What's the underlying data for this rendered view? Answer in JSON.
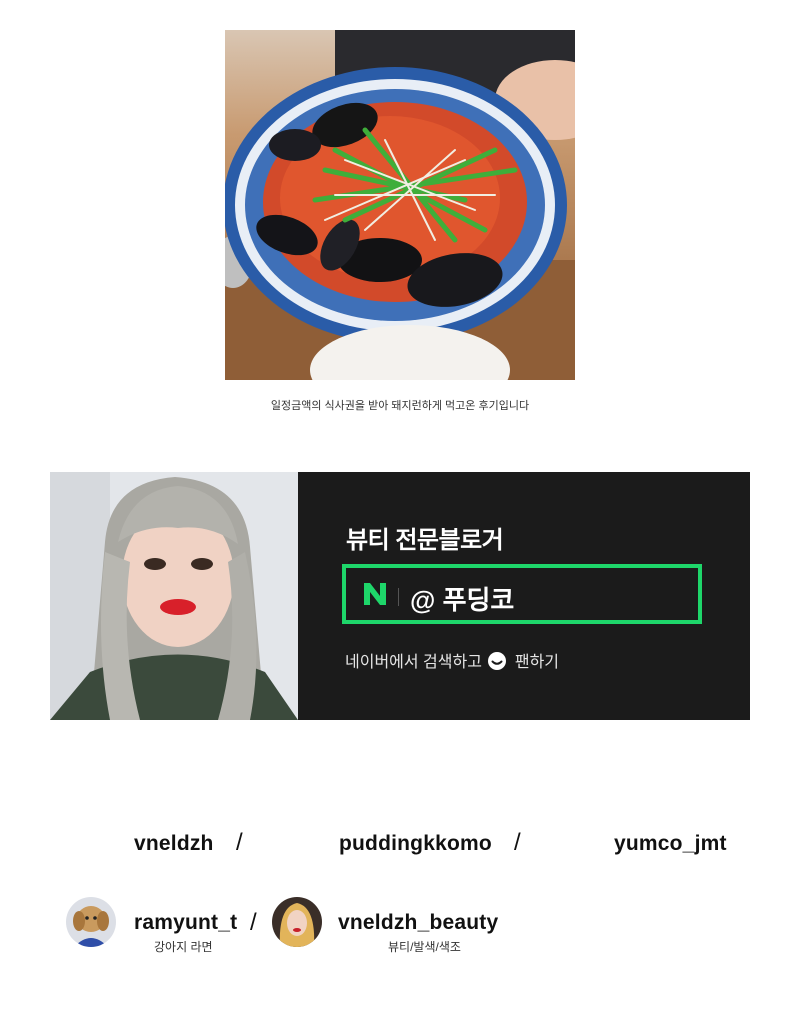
{
  "photo": {
    "caption": "일정금액의 식사권을 받아 돼지런하게 먹고온 후기입니다"
  },
  "banner": {
    "title": "뷰티 전문블로거",
    "handle": "@ 푸딩코",
    "subtitle_before": "네이버에서 검색하고",
    "subtitle_after": "팬하기",
    "accent_color": "#1ed66a"
  },
  "accounts_row1": [
    "vneldzh",
    "/",
    "puddingkkomo",
    "/",
    "yumco_jmt"
  ],
  "accounts_row2": [
    {
      "name": "ramyunt_t",
      "desc": "강아지 라면"
    },
    {
      "separator": "/"
    },
    {
      "name": "vneldzh_beauty",
      "desc": "뷰티/발색/색조"
    }
  ]
}
